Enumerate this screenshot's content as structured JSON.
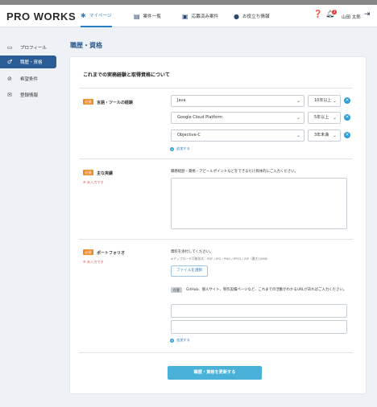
{
  "header": {
    "logo": "PRO WORKS",
    "nav": [
      {
        "label": "マイページ",
        "icon": "gear-icon"
      },
      {
        "label": "案件一覧",
        "icon": "list-icon"
      },
      {
        "label": "応募済み案件",
        "icon": "briefcase-icon"
      },
      {
        "label": "お役立ち情報",
        "icon": "people-icon"
      }
    ],
    "notification_count": "3",
    "user_name": "山田 太郎"
  },
  "sidebar": {
    "items": [
      {
        "label": "プロフィール",
        "icon": "profile-card-icon"
      },
      {
        "label": "職歴・資格",
        "icon": "career-icon"
      },
      {
        "label": "希望条件",
        "icon": "check-circle-icon"
      },
      {
        "label": "登録情報",
        "icon": "mail-icon"
      }
    ]
  },
  "page": {
    "title": "職歴・資格",
    "card_title": "これまでの実務経験と取得資格について"
  },
  "skills_section": {
    "required_badge": "必須",
    "label": "言語・ツールの経験",
    "rows": [
      {
        "skill": "Java",
        "years": "10年以上"
      },
      {
        "skill": "Google Cloud Platform",
        "years": "5年以上"
      },
      {
        "skill": "Objective-C",
        "years": "3年未満"
      }
    ],
    "add_label": "追加する"
  },
  "achievements_section": {
    "required_badge": "必須",
    "label": "主な実績",
    "warning": "※ 未入力です",
    "help": "職務経歴・資格・アピールポイントなどをできるだけ具体的にご入力ください。"
  },
  "portfolio_section": {
    "required_badge": "必須",
    "label": "ポートフォリオ",
    "warning": "※ 未入力です",
    "help": "資料を添付してください。",
    "note": "※アップロード可能形式：PDF / JPG / PNG / PPTX / ZIP（最大10MB）",
    "file_button": "ファイルを選択",
    "any_badge": "任意",
    "url_help": "GitHub、個人サイト、制作実績ページなど、これまでの活動がわかるURLがあればご入力ください。",
    "add_label": "追加する"
  },
  "submit_label": "職歴・資格を更新する"
}
